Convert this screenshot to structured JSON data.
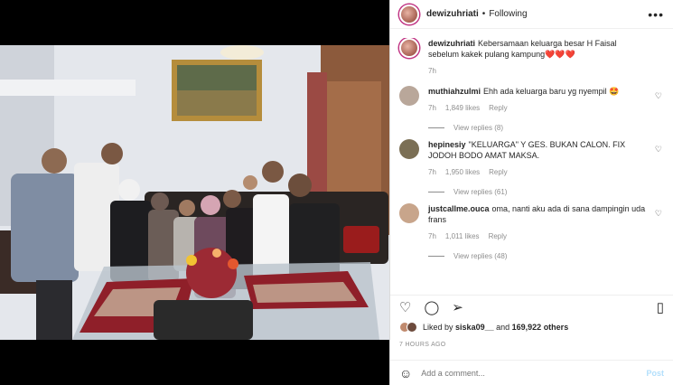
{
  "post": {
    "username": "dewizuhriati",
    "follow_state": "Following",
    "caption_user": "dewizuhriati",
    "caption": "Kebersamaan keluarga besar H Faisal sebelum kakek pulang kampung❤️❤️❤️",
    "caption_age": "7h"
  },
  "comments": [
    {
      "user": "muthiahzulmi",
      "text": "Ehh ada keluarga baru yg nyempil 🤩",
      "age": "7h",
      "likes": "1,849 likes",
      "reply": "Reply",
      "view_replies": "View replies (8)",
      "avatar_color": "#b9a79a"
    },
    {
      "user": "hepinesiy",
      "text": "\"KELUARGA\" Y GES. BUKAN CALON. FIX JODOH BODO AMAT MAKSA.",
      "age": "7h",
      "likes": "1,950 likes",
      "reply": "Reply",
      "view_replies": "View replies (61)",
      "avatar_color": "#7b6f55"
    },
    {
      "user": "justcallme.ouca",
      "text": "oma, nanti aku ada di sana dampingin uda frans",
      "age": "7h",
      "likes": "1,011 likes",
      "reply": "Reply",
      "view_replies": "View replies (48)",
      "avatar_color": "#c8a58b"
    }
  ],
  "likes": {
    "prefix": "Liked by",
    "user": "siska09__",
    "connector": "and",
    "count": "169,922 others"
  },
  "time_ago": "7 HOURS AGO",
  "add_comment": {
    "placeholder": "Add a comment...",
    "post_label": "Post"
  },
  "icons": {
    "more": "more-icon",
    "heart": "heart-icon",
    "comment": "comment-icon",
    "share": "share-icon",
    "save": "bookmark-icon",
    "emoji": "emoji-icon"
  }
}
